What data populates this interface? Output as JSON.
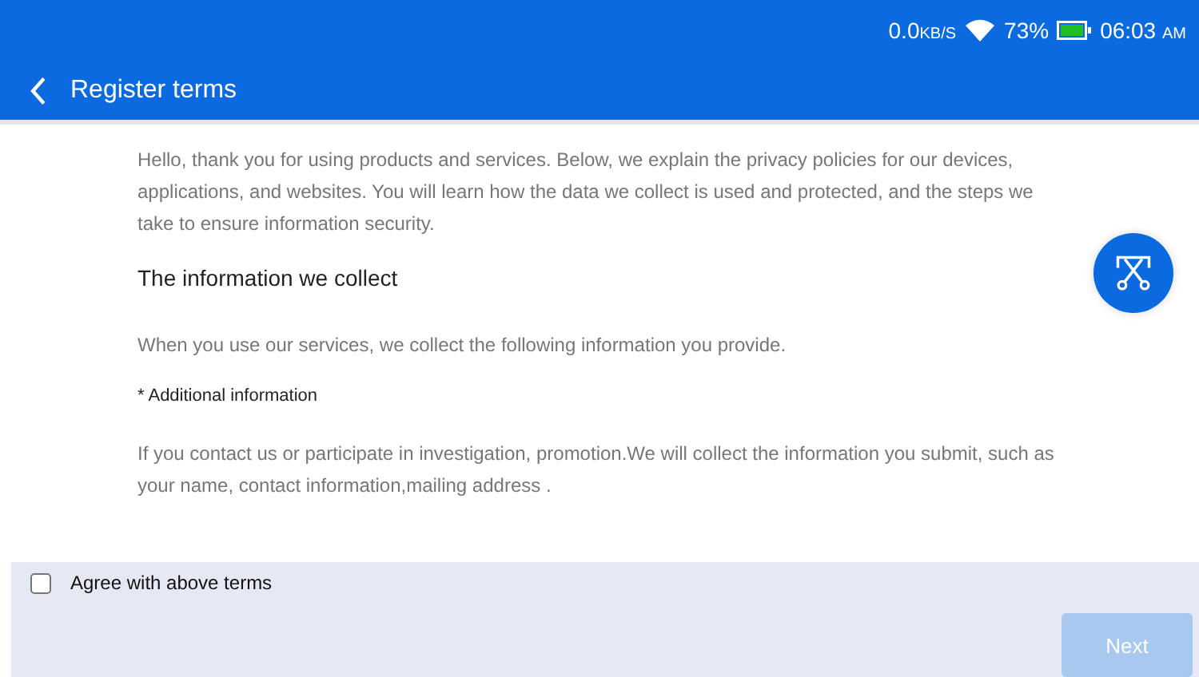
{
  "status_bar": {
    "speed": "0.0",
    "speed_unit": "KB/S",
    "battery": "73%",
    "time": "06:03",
    "meridiem": "AM"
  },
  "header": {
    "title": "Register terms"
  },
  "content": [
    {
      "kind": "body",
      "text": "Hello, thank you for using products and services. Below, we explain the privacy policies for our devices, applications, and websites. You will learn how the data we collect is used and protected, and the steps we take to ensure information security."
    },
    {
      "kind": "heading",
      "text": "The information we collect"
    },
    {
      "kind": "body",
      "text": "When you use our services, we collect the following information you provide."
    },
    {
      "kind": "subheading",
      "text": "* Additional information"
    },
    {
      "kind": "body",
      "text": "If you contact us or participate in investigation, promotion.We will collect the information you submit, such as your name, contact information,mailing address ."
    }
  ],
  "agree": {
    "label": "Agree with above terms",
    "checked": false
  },
  "next_button": {
    "label": "Next",
    "disabled": true
  }
}
